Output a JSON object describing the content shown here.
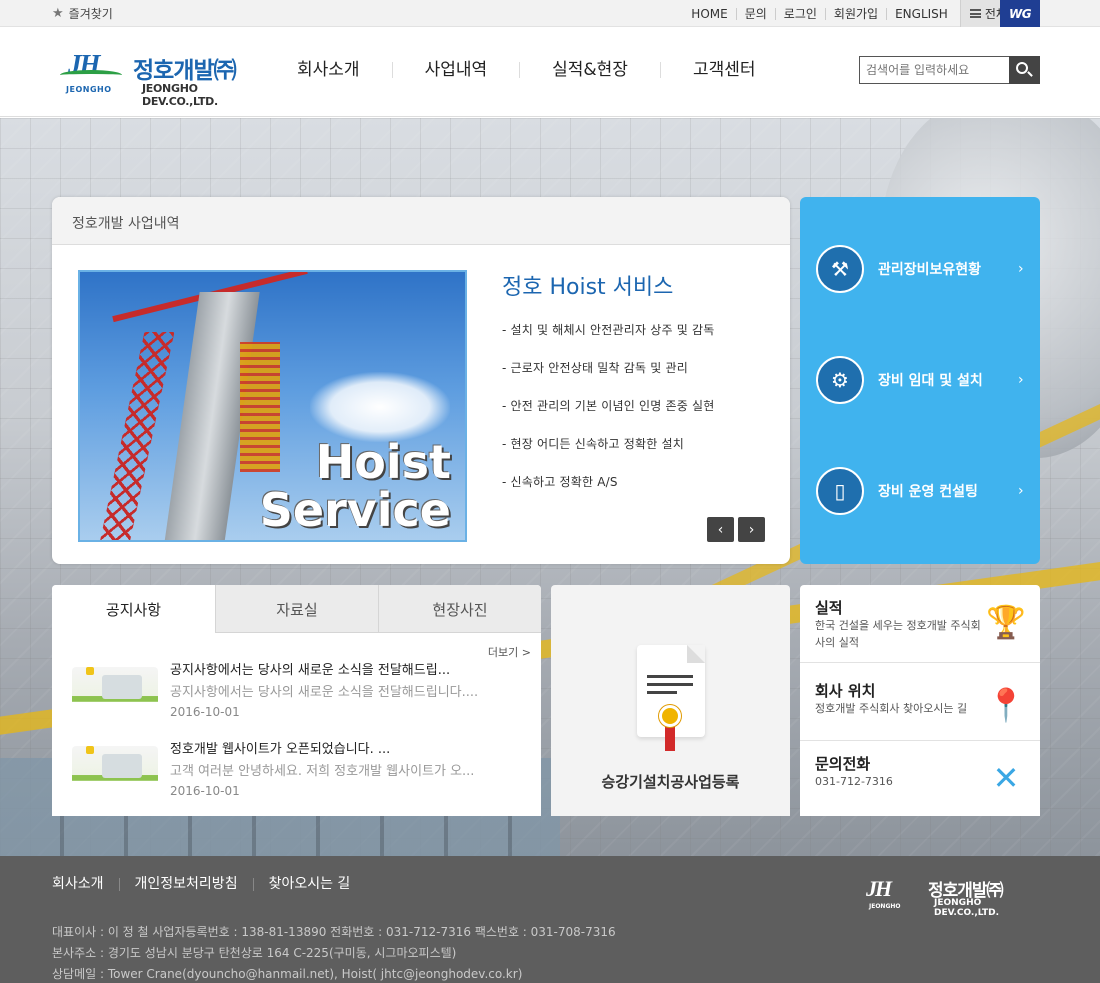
{
  "topbar": {
    "favorites": "즐겨찾기",
    "links": [
      "HOME",
      "문의",
      "로그인",
      "회원가입",
      "ENGLISH"
    ],
    "all_menu": "전체메뉴",
    "badge": "WG"
  },
  "header": {
    "logo_mark": "JH",
    "logo_sub": "JEONGHO",
    "logo_ko": "정호개발㈜",
    "logo_en": "JEONGHO DEV.CO.,LTD.",
    "nav": [
      "회사소개",
      "사업내역",
      "실적&현장",
      "고객센터"
    ],
    "search_placeholder": "검색어를 입력하세요"
  },
  "business": {
    "heading": "정호개발 사업내역",
    "photo_text_1": "Hoist",
    "photo_text_2": "Service",
    "title": "정호 Hoist 서비스",
    "items": [
      "- 설치 및 해체시 안전관리자 상주 및 감독",
      "- 근로자 안전상태 밀착 감독 및 관리",
      "- 안전 관리의 기본 이념인 인명 존중 실현",
      "- 현장 어디든 신속하고 정확한 설치",
      "- 신속하고 정확한 A/S"
    ],
    "prev": "‹",
    "next": "›"
  },
  "quick": [
    {
      "label": "관리장비보유현황",
      "icon": "crane-icon"
    },
    {
      "label": "장비 임대 및 설치",
      "icon": "gear-icon"
    },
    {
      "label": "장비 운영 컨설팅",
      "icon": "tablet-icon"
    }
  ],
  "board": {
    "tabs": [
      "공지사항",
      "자료실",
      "현장사진"
    ],
    "more": "더보기 >",
    "posts": [
      {
        "title": "공지사항에서는 당사의 새로운 소식을 전달해드립...",
        "desc": "공지사항에서는 당사의 새로운 소식을 전달해드립니다....",
        "date": "2016-10-01"
      },
      {
        "title": "정호개발 웹사이트가 오픈되었습니다. ...",
        "desc": "고객 여러분 안녕하세요. 저희 정호개발 웹사이트가 오...",
        "date": "2016-10-01"
      }
    ]
  },
  "registration": {
    "label": "승강기설치공사업등록"
  },
  "info": [
    {
      "title": "실적",
      "sub": "한국 건설을 세우는 정호개발 주식회사의 실적",
      "icon": "trophy-icon"
    },
    {
      "title": "회사 위치",
      "sub": "정호개발 주식회사 찾아오시는 길",
      "icon": "map-pin-icon"
    },
    {
      "title": "문의전화",
      "sub": "031-712-7316",
      "icon": "tools-icon"
    }
  ],
  "footer": {
    "nav": [
      "회사소개",
      "개인정보처리방침",
      "찾아오시는 길"
    ],
    "line1": "대표이사 : 이 정 철   사업자등록번호 : 138-81-13890   전화번호 : 031-712-7316   팩스번호 : 031-708-7316",
    "line2": "본사주소 : 경기도 성남시 분당구 탄천상로 164 C-225(구미동, 시그마오피스텔)",
    "line3": "상담메일 : Tower Crane(dyouncho@hanmail.net), Hoist( jhtc@jeonghodev.co.kr)",
    "logo_mark": "JH",
    "logo_sub": "JEONGHO",
    "logo_ko": "정호개발㈜",
    "logo_en": "JEONGHO DEV.CO.,LTD."
  },
  "colors": {
    "brand_blue": "#1c66b0",
    "quick_blue": "#40b3ee",
    "footer_gray": "#5e5e5e"
  }
}
